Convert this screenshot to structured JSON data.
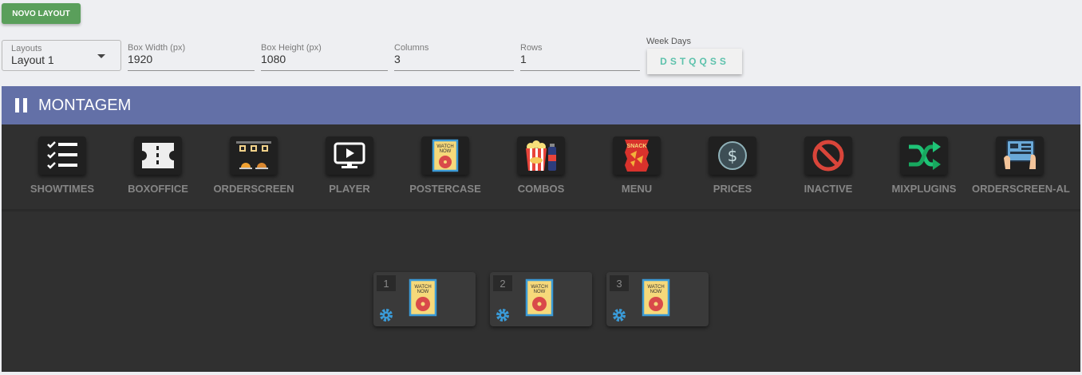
{
  "toolbar": {
    "new_layout_label": "NOVO LAYOUT"
  },
  "form": {
    "layouts": {
      "label": "Layouts",
      "value": "Layout 1"
    },
    "box_width": {
      "label": "Box Width (px)",
      "value": "1920"
    },
    "box_height": {
      "label": "Box Height (px)",
      "value": "1080"
    },
    "columns": {
      "label": "Columns",
      "value": "3"
    },
    "rows": {
      "label": "Rows",
      "value": "1"
    },
    "week_days": {
      "label": "Week Days",
      "value": "DSTQQSS"
    }
  },
  "section": {
    "title": "MONTAGEM"
  },
  "plugins": [
    {
      "name": "SHOWTIMES",
      "icon": "checklist-icon"
    },
    {
      "name": "BOXOFFICE",
      "icon": "ticket-icon"
    },
    {
      "name": "ORDERSCREEN",
      "icon": "food-order-icon"
    },
    {
      "name": "PLAYER",
      "icon": "monitor-play-icon"
    },
    {
      "name": "POSTERCASE",
      "icon": "poster-icon"
    },
    {
      "name": "COMBOS",
      "icon": "popcorn-icon"
    },
    {
      "name": "MENU",
      "icon": "snack-icon"
    },
    {
      "name": "PRICES",
      "icon": "dollar-icon"
    },
    {
      "name": "INACTIVE",
      "icon": "prohibited-icon"
    },
    {
      "name": "MIXPLUGINS",
      "icon": "shuffle-icon"
    },
    {
      "name": "ORDERSCREEN-AL",
      "icon": "tablet-order-icon"
    }
  ],
  "grid_cells": [
    {
      "number": "1",
      "plugin_icon": "poster-icon"
    },
    {
      "number": "2",
      "plugin_icon": "poster-icon"
    },
    {
      "number": "3",
      "plugin_icon": "poster-icon"
    }
  ],
  "colors": {
    "header_bg": "#6370a7",
    "new_button": "#5a9f5b",
    "week_days_text": "#5dc2ac",
    "gear": "#3a9bd8"
  }
}
